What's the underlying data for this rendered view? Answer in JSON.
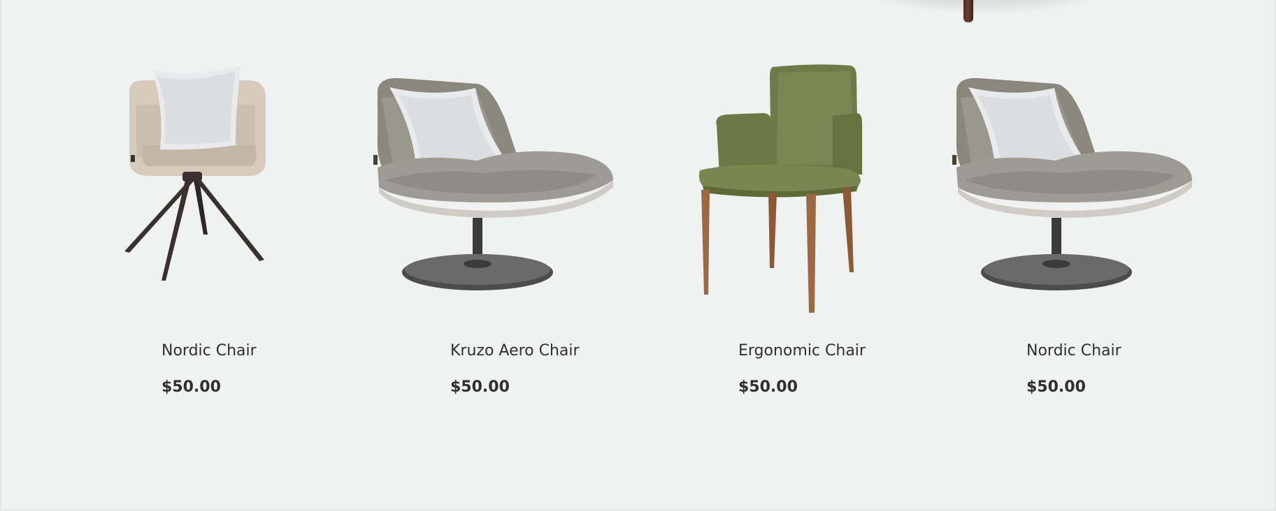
{
  "products": [
    {
      "name": "Nordic Chair",
      "price": "$50.00",
      "image": "nordic-swivel-chair"
    },
    {
      "name": "Kruzo Aero Chair",
      "price": "$50.00",
      "image": "lounge-swivel-chair"
    },
    {
      "name": "Ergonomic Chair",
      "price": "$50.00",
      "image": "green-armchair"
    },
    {
      "name": "Nordic Chair",
      "price": "$50.00",
      "image": "lounge-swivel-chair"
    }
  ],
  "colors": {
    "background": "#eff2f1",
    "text": "#2f2f2f"
  }
}
